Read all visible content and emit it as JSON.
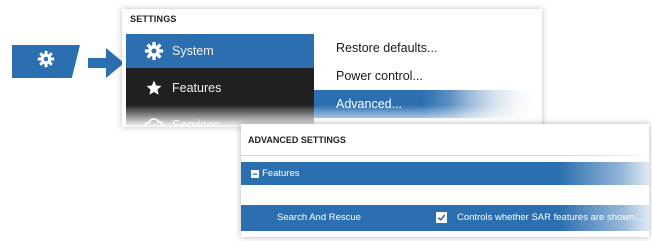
{
  "colors": {
    "accent": "#2b6fb0",
    "dark_panel": "#202020",
    "panel_bg": "#ffffff"
  },
  "shortcut": {
    "icon": "gear-icon"
  },
  "settings": {
    "title": "SETTINGS",
    "categories": [
      {
        "label": "System",
        "icon": "gear-icon",
        "selected": true
      },
      {
        "label": "Features",
        "icon": "star-icon",
        "selected": false
      },
      {
        "label": "Services",
        "icon": "cloud-icon",
        "selected": false
      }
    ],
    "options": [
      {
        "label": "Restore defaults...",
        "selected": false
      },
      {
        "label": "Power control...",
        "selected": false
      },
      {
        "label": "Advanced...",
        "selected": true
      }
    ]
  },
  "advanced": {
    "title": "ADVANCED SETTINGS",
    "group": {
      "label": "Features",
      "toggle": "−"
    },
    "rows": [
      {
        "label": "Search And Rescue",
        "checked": true,
        "description": "Controls whether SAR features are shown..."
      }
    ]
  }
}
